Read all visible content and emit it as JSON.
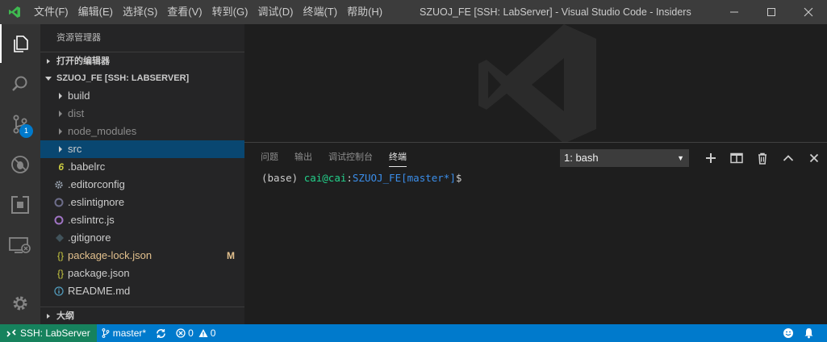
{
  "titlebar": {
    "menu": [
      "文件(F)",
      "编辑(E)",
      "选择(S)",
      "查看(V)",
      "转到(G)",
      "调试(D)",
      "终端(T)",
      "帮助(H)"
    ],
    "title": "SZUOJ_FE [SSH: LabServer] - Visual Studio Code - Insiders"
  },
  "activitybar": {
    "items": [
      "explorer-icon",
      "search-icon",
      "source-control-icon",
      "debug-icon",
      "extensions-icon",
      "remote-explorer-icon"
    ],
    "scm_badge": "1"
  },
  "sidebar": {
    "title": "资源管理器",
    "open_editors": "打开的编辑器",
    "folder": "SZUOJ_FE [SSH: LABSERVER]",
    "items": [
      {
        "label": "build",
        "type": "folder"
      },
      {
        "label": "dist",
        "type": "folder"
      },
      {
        "label": "node_modules",
        "type": "folder"
      },
      {
        "label": "src",
        "type": "folder"
      },
      {
        "label": ".babelrc",
        "type": "file",
        "icon": "babel-icon"
      },
      {
        "label": ".editorconfig",
        "type": "file",
        "icon": "gear-icon"
      },
      {
        "label": ".eslintignore",
        "type": "file",
        "icon": "eslint-icon"
      },
      {
        "label": ".eslintrc.js",
        "type": "file",
        "icon": "eslint-icon"
      },
      {
        "label": ".gitignore",
        "type": "file",
        "icon": "git-icon"
      },
      {
        "label": "package-lock.json",
        "type": "file",
        "icon": "json-icon",
        "mark": "M"
      },
      {
        "label": "package.json",
        "type": "file",
        "icon": "json-icon"
      },
      {
        "label": "README.md",
        "type": "file",
        "icon": "info-icon"
      }
    ],
    "outline": "大纲"
  },
  "panel": {
    "tabs": [
      "问题",
      "输出",
      "调试控制台",
      "终端"
    ],
    "terminal_select": "1: bash",
    "terminal": {
      "env": "(base) ",
      "user": "cai@cai",
      "colon": ":",
      "path": "SZUOJ_FE[master*]",
      "prompt": "$"
    }
  },
  "statusbar": {
    "remote": "SSH: LabServer",
    "branch": "master*",
    "errors": "0",
    "warnings": "0"
  },
  "colors": {
    "statusbar": "#007acc",
    "remote": "#16825d",
    "selection": "#094771",
    "modified": "#e2c08d"
  }
}
